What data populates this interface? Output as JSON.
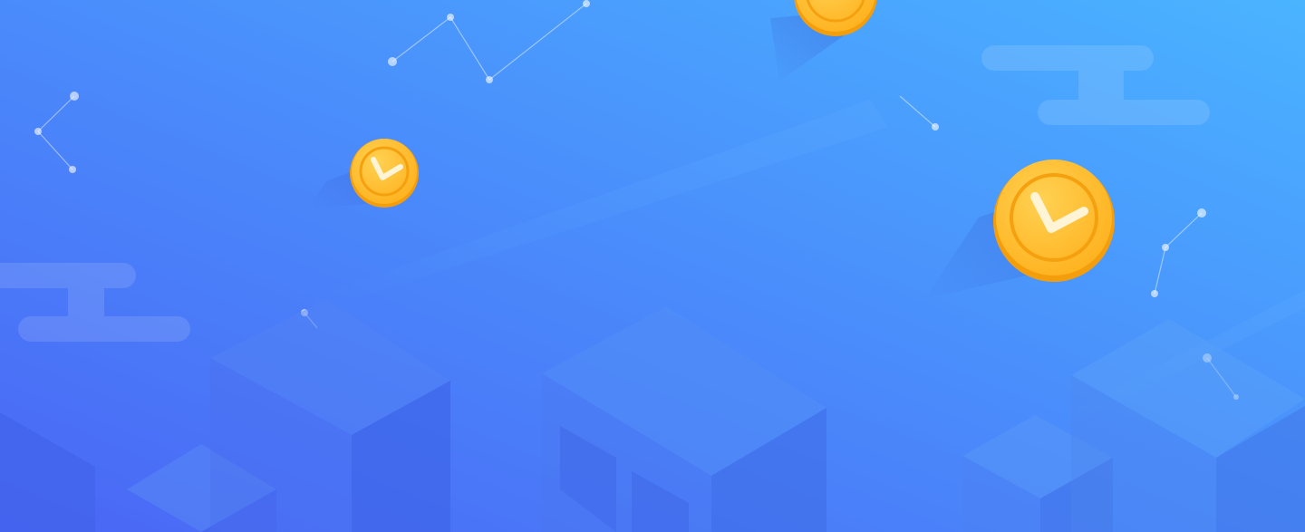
{
  "banner": {
    "colors": {
      "gradient_start": "#4A6DF7",
      "gradient_end": "#4AB2FF",
      "coin_face": "#FFC033",
      "coin_rim": "#F5A00F",
      "coin_mark": "#FFF4D6"
    },
    "icons": [
      "coin-v-icon",
      "constellation-lines",
      "cloud-shapes",
      "isometric-blocks"
    ]
  }
}
